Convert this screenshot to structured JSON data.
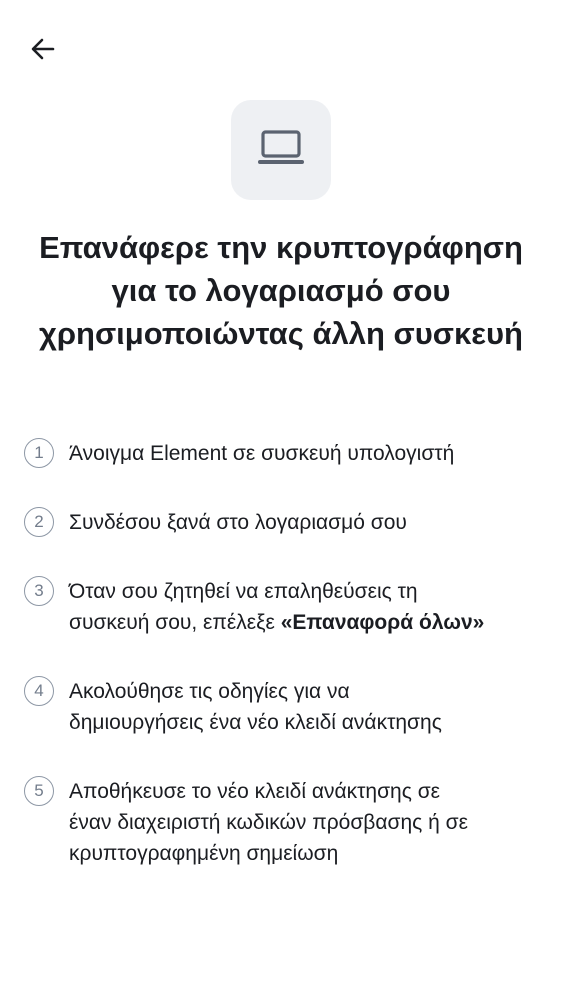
{
  "header": {
    "back_icon": "arrow-left-icon"
  },
  "hero": {
    "icon": "laptop-icon"
  },
  "title": {
    "line1": "Επανάφερε την κρυπτογράφηση",
    "line2": "για το λογαριασμό σου",
    "line3": "χρησιμοποιώντας άλλη συσκευή"
  },
  "steps": [
    {
      "number": "1",
      "text": "Άνοιγμα Element σε συσκευή υπολογιστή"
    },
    {
      "number": "2",
      "text": "Συνδέσου ξανά στο λογαριασμό σου"
    },
    {
      "number": "3",
      "line1": "Όταν σου ζητηθεί να επαληθεύσεις τη",
      "line2_prefix": "συσκευή σου, επέλεξε ",
      "line2_bold": "«Επαναφορά όλων»"
    },
    {
      "number": "4",
      "line1": "Ακολούθησε τις οδηγίες για να",
      "line2": "δημιουργήσεις ένα νέο κλειδί ανάκτησης"
    },
    {
      "number": "5",
      "line1": "Αποθήκευσε το νέο κλειδί ανάκτησης σε",
      "line2": "έναν διαχειριστή κωδικών πρόσβασης ή σε",
      "line3": "κρυπτογραφημένη σημείωση"
    }
  ],
  "colors": {
    "text": "#1b1d22",
    "icon_bg": "#eef0f3",
    "badge_border": "#8d97a5",
    "icon": "#5b6370"
  }
}
